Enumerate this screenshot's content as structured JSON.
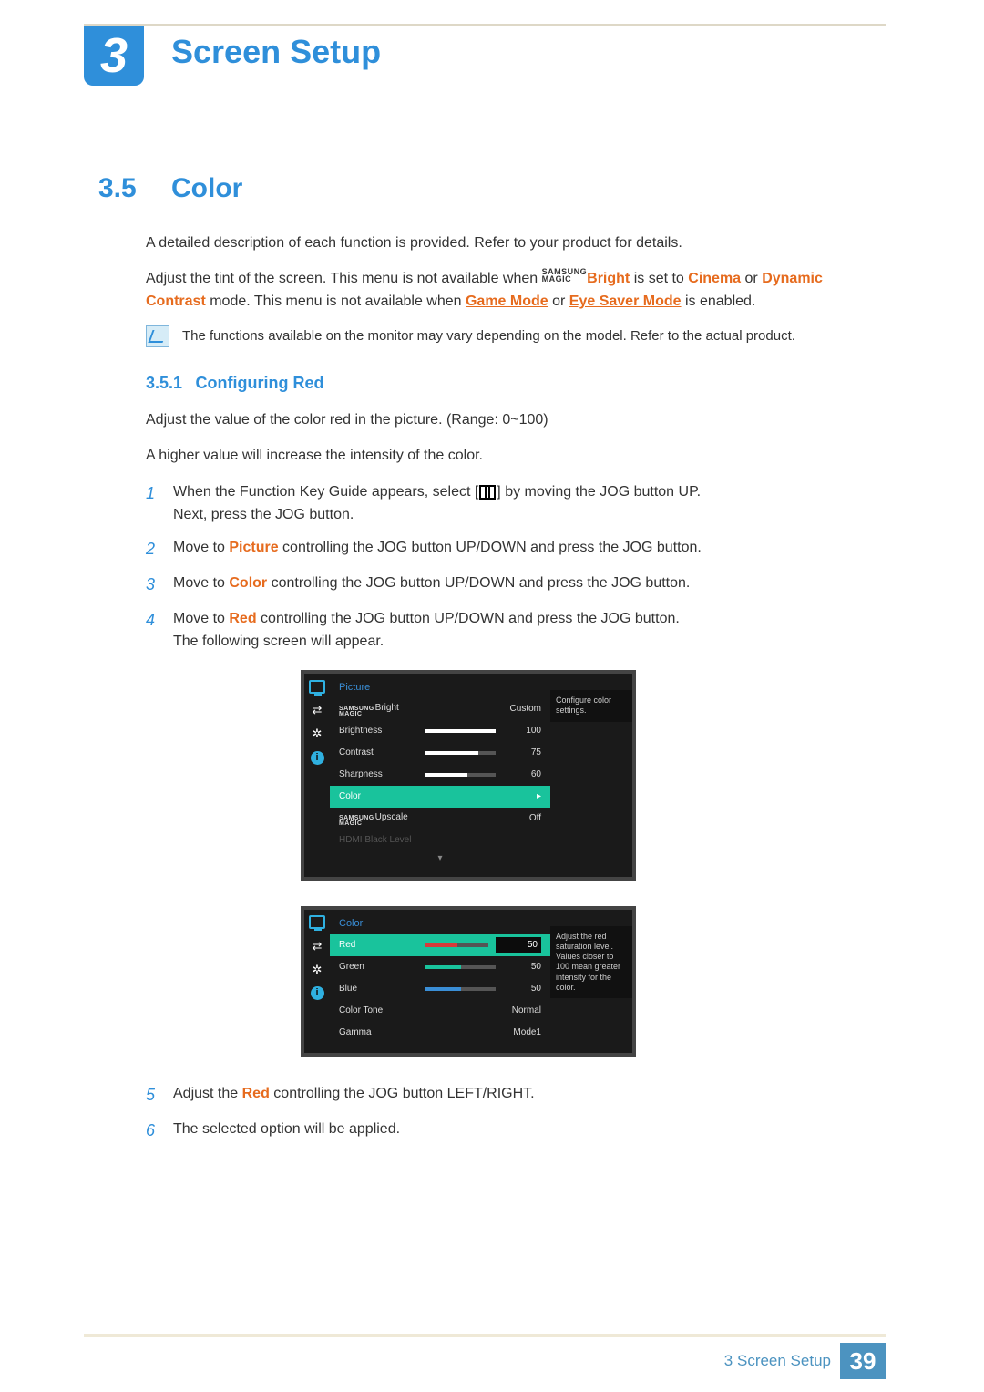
{
  "chapter": {
    "number": "3",
    "title": "Screen Setup"
  },
  "section": {
    "number": "3.5",
    "title": "Color"
  },
  "intro1": "A detailed description of each function is provided. Refer to your product for details.",
  "intro2": {
    "pre": "Adjust the tint of the screen. This menu is not available when ",
    "magic_samsung": "SAMSUNG",
    "magic_magic": "MAGIC",
    "bright_link": "Bright",
    "mid1": " is set to ",
    "cinema": "Cinema",
    "mid2": " or ",
    "dynamic_contrast": "Dynamic Contrast",
    "mid3": " mode. This menu is not available when ",
    "game_mode": "Game Mode",
    "mid4": " or ",
    "eye_saver": "Eye Saver Mode",
    "tail": " is enabled."
  },
  "note": "The functions available on the monitor may vary depending on the model. Refer to the actual product.",
  "subsection": {
    "number": "3.5.1",
    "title": "Configuring Red"
  },
  "sub_p1": "Adjust the value of the color red in the picture. (Range: 0~100)",
  "sub_p2": "A higher value will increase the intensity of the color.",
  "steps": {
    "s1a": "When the Function Key Guide appears, select [",
    "s1b": "] by moving the JOG button UP.",
    "s1c": "Next, press the JOG button.",
    "s2a": "Move to ",
    "s2_picture": "Picture",
    "s2b": " controlling the JOG button UP/DOWN and press the JOG button.",
    "s3a": "Move to ",
    "s3_color": "Color",
    "s3b": " controlling the JOG button UP/DOWN and press the JOG button.",
    "s4a": "Move to ",
    "s4_red": "Red",
    "s4b": " controlling the JOG button UP/DOWN and press the JOG button.",
    "s4c": "The following screen will appear.",
    "s5a": "Adjust the ",
    "s5_red": "Red",
    "s5b": " controlling the JOG button LEFT/RIGHT.",
    "s6": "The selected option will be applied."
  },
  "osd1": {
    "title": "Picture",
    "tip": "Configure color settings.",
    "rows": [
      {
        "label_samsung": "SAMSUNG",
        "label_magic": "MAGIC",
        "label_suffix": "Bright",
        "value": "Custom",
        "bar": null
      },
      {
        "label": "Brightness",
        "value": "100",
        "bar": 100
      },
      {
        "label": "Contrast",
        "value": "75",
        "bar": 75
      },
      {
        "label": "Sharpness",
        "value": "60",
        "bar": 60
      },
      {
        "label": "Color",
        "value": "",
        "selected": true,
        "arrow": true
      },
      {
        "label_samsung": "SAMSUNG",
        "label_magic": "MAGIC",
        "label_suffix": "Upscale",
        "value": "Off"
      },
      {
        "label": "HDMI Black Level",
        "dim": true
      }
    ]
  },
  "osd2": {
    "title": "Color",
    "tip": "Adjust the red saturation level. Values closer to 100 mean greater intensity for the color.",
    "rows": [
      {
        "label": "Red",
        "value": "50",
        "bar": 50,
        "color": "red",
        "selected": true
      },
      {
        "label": "Green",
        "value": "50",
        "bar": 50,
        "color": "green"
      },
      {
        "label": "Blue",
        "value": "50",
        "bar": 50,
        "color": "blue"
      },
      {
        "label": "Color Tone",
        "value": "Normal"
      },
      {
        "label": "Gamma",
        "value": "Mode1"
      }
    ]
  },
  "footer": {
    "text": "3 Screen Setup",
    "page": "39"
  }
}
